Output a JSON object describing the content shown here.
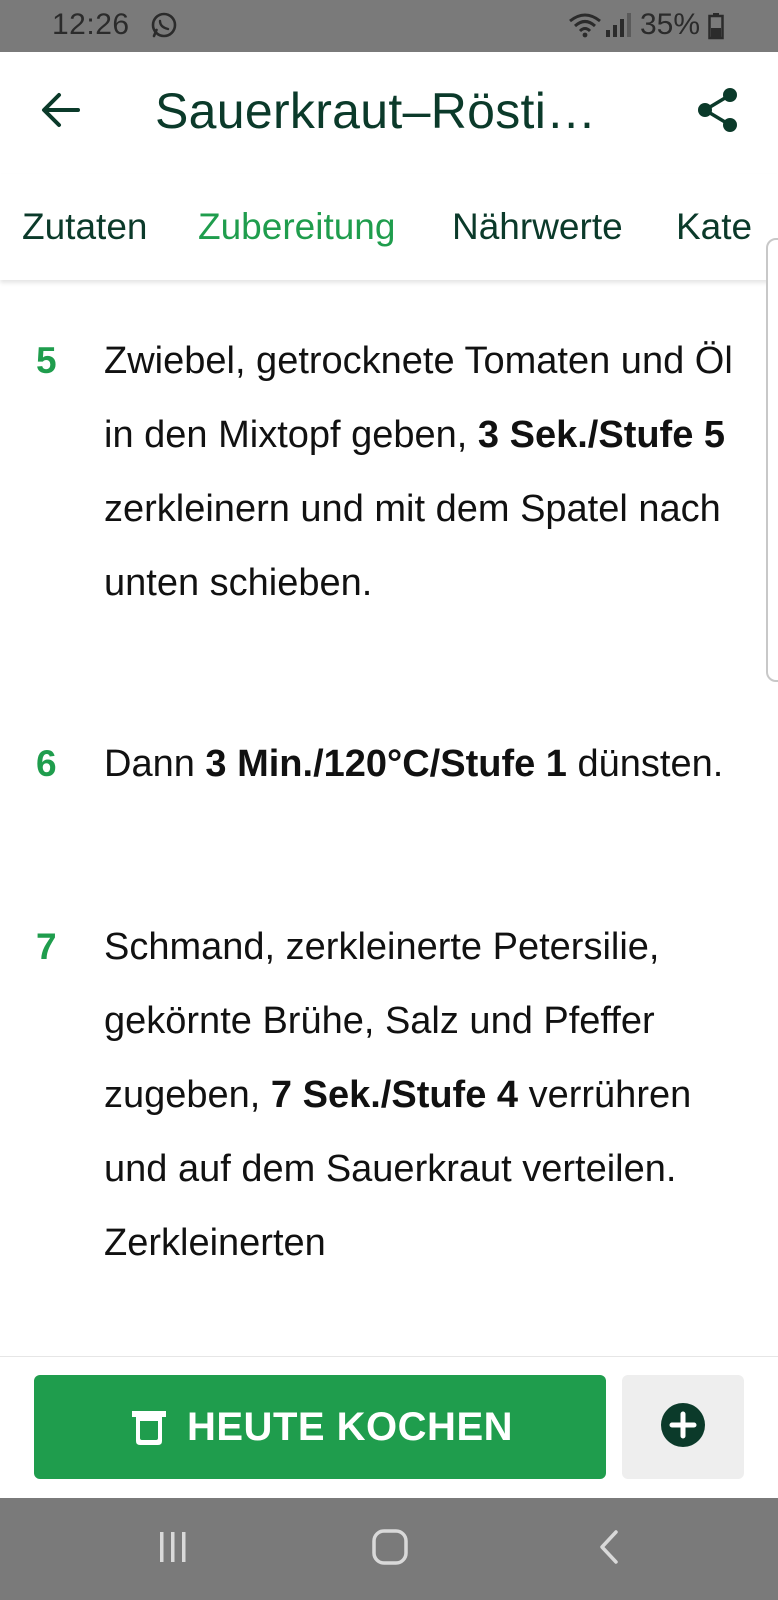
{
  "status_bar": {
    "time": "12:26",
    "battery": "35%",
    "icons": [
      "whatsapp-icon",
      "wifi-icon",
      "signal-icon",
      "battery-icon"
    ]
  },
  "app_bar": {
    "title": "Sauerkraut–Rösti…",
    "back_icon": "arrow-left-icon",
    "share_icon": "share-icon"
  },
  "tabs": [
    {
      "label": "Zutaten",
      "active": false
    },
    {
      "label": "Zubereitung",
      "active": true
    },
    {
      "label": "Nährwerte",
      "active": false
    },
    {
      "label": "Kate",
      "active": false
    }
  ],
  "steps": [
    {
      "number": "5",
      "parts": [
        {
          "text": "Zwiebel, getrocknete Tomaten und Öl in den Mixtopf geben, ",
          "bold": false
        },
        {
          "text": "3 Sek./Stufe 5",
          "bold": true
        },
        {
          "text": " zerkleinern und mit dem Spatel nach unten schieben.",
          "bold": false
        }
      ]
    },
    {
      "number": "6",
      "parts": [
        {
          "text": "Dann ",
          "bold": false
        },
        {
          "text": "3 Min./120°C/Stufe 1",
          "bold": true
        },
        {
          "text": " dünsten.",
          "bold": false
        }
      ]
    },
    {
      "number": "7",
      "parts": [
        {
          "text": "Schmand, zerkleinerte Petersilie, gekörnte Brühe, Salz und Pfeffer zugeben, ",
          "bold": false
        },
        {
          "text": "7 Sek./Stufe 4",
          "bold": true
        },
        {
          "text": " verrühren und auf dem Sauerkraut verteilen. Zerkleinerten",
          "bold": false
        }
      ]
    }
  ],
  "bottom_actions": {
    "cook_label": "HEUTE KOCHEN",
    "cook_icon": "thermomix-pot-icon",
    "add_icon": "plus-circle-icon"
  },
  "nav_bar": {
    "icons": [
      "recent-apps-icon",
      "home-icon",
      "back-icon"
    ]
  },
  "colors": {
    "accent_green": "#1f9d4d",
    "title_dark_green": "#0b3a2a",
    "system_bar_gray": "#7a7a7a"
  }
}
